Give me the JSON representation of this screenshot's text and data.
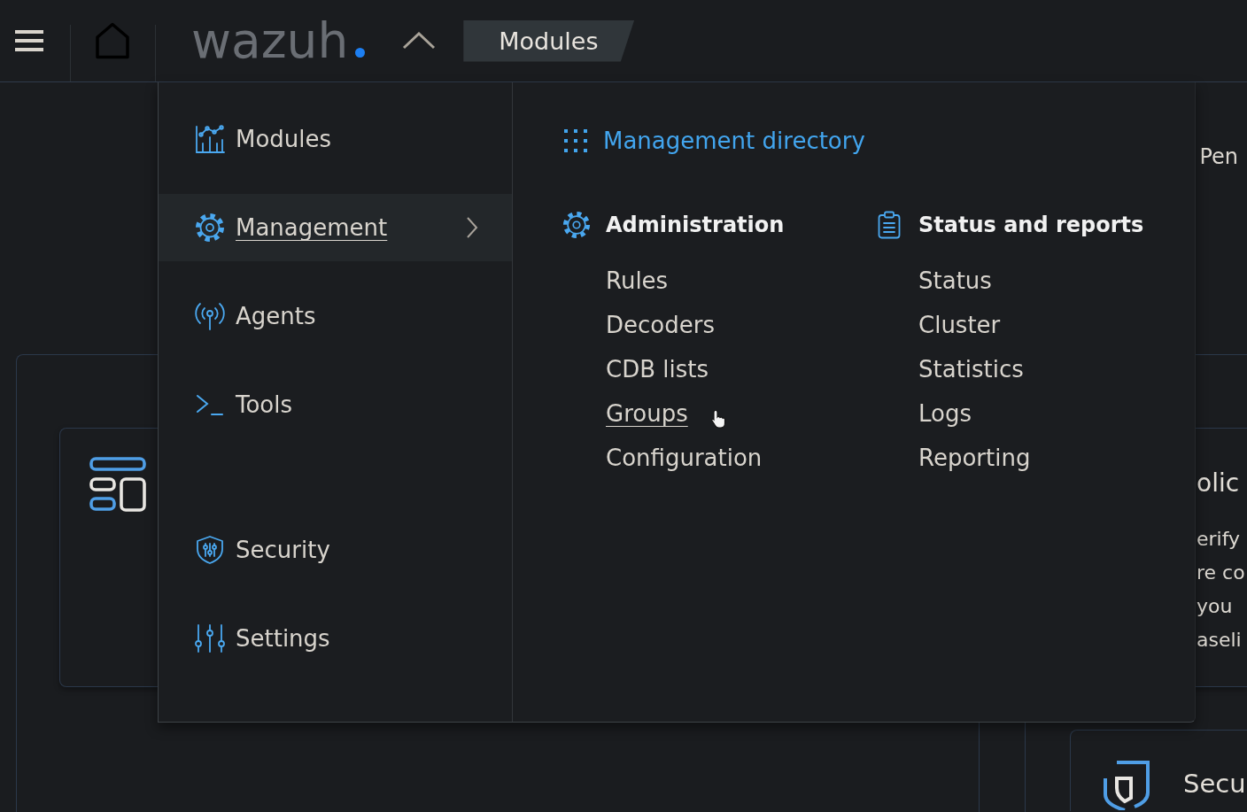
{
  "header": {
    "logo": "wazuh",
    "menu_expanded": true,
    "breadcrumb": "Modules"
  },
  "menu": {
    "groups": [
      {
        "items": [
          {
            "label": "Modules",
            "selected": false,
            "submenu": false
          },
          {
            "label": "Management",
            "selected": true,
            "submenu": true
          },
          {
            "label": "Agents",
            "selected": false,
            "submenu": false
          },
          {
            "label": "Tools",
            "selected": false,
            "submenu": false
          }
        ]
      },
      {
        "items": [
          {
            "label": "Security",
            "selected": false,
            "submenu": false
          },
          {
            "label": "Settings",
            "selected": false,
            "submenu": false
          }
        ]
      }
    ],
    "directory_link": "Management directory",
    "columns": [
      {
        "heading": "Administration",
        "links": [
          {
            "label": "Rules",
            "hovered": false
          },
          {
            "label": "Decoders",
            "hovered": false
          },
          {
            "label": "CDB lists",
            "hovered": false
          },
          {
            "label": "Groups",
            "hovered": true
          },
          {
            "label": "Configuration",
            "hovered": false
          }
        ]
      },
      {
        "heading": "Status and reports",
        "links": [
          {
            "label": "Status",
            "hovered": false
          },
          {
            "label": "Cluster",
            "hovered": false
          },
          {
            "label": "Statistics",
            "hovered": false
          },
          {
            "label": "Logs",
            "hovered": false
          },
          {
            "label": "Reporting",
            "hovered": false
          }
        ]
      }
    ]
  },
  "background": {
    "top_label": "Pen",
    "card": {
      "title": "olic",
      "description": [
        "erify",
        "re co",
        "you",
        "aseli"
      ]
    },
    "lower_card": {
      "title": "Secu"
    }
  }
}
